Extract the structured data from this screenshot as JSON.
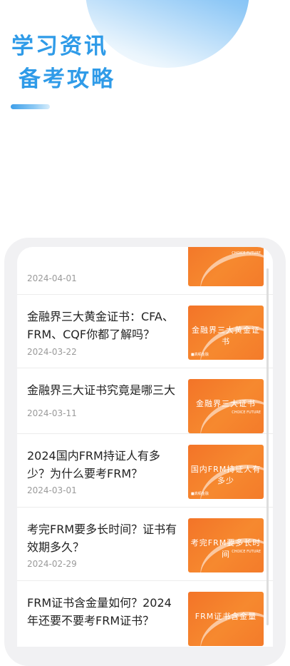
{
  "hero": {
    "line1": "学习资讯",
    "line2": "备考攻略"
  },
  "articles": [
    {
      "title": "",
      "date": "2024-04-01",
      "thumb_caption": ""
    },
    {
      "title": "金融界三大黄金证书：CFA、FRM、CQF你都了解吗？",
      "date": "2024-03-22",
      "thumb_caption": "金融界三大黄金证书"
    },
    {
      "title": "金融界三大证书究竟是哪三大",
      "date": "2024-03-11",
      "thumb_caption": "金融界三大证书"
    },
    {
      "title": "2024国内FRM持证人有多少？为什么要考FRM？",
      "date": "2024-03-01",
      "thumb_caption": "国内FRM持证人有多少"
    },
    {
      "title": "考完FRM要多长时间？证书有效期多久？",
      "date": "2024-02-29",
      "thumb_caption": "考完FRM要多长时间"
    },
    {
      "title": "FRM证书含金量如何？2024年还要不要考FRM证书？",
      "date": "",
      "thumb_caption": "FRM证书含金量"
    }
  ],
  "thumb_brand": "CHOICE FUTURE",
  "thumb_mark": "■高顿金融",
  "colors": {
    "accent_blue": "#2f9be8",
    "thumb_orange": "#f37428"
  }
}
